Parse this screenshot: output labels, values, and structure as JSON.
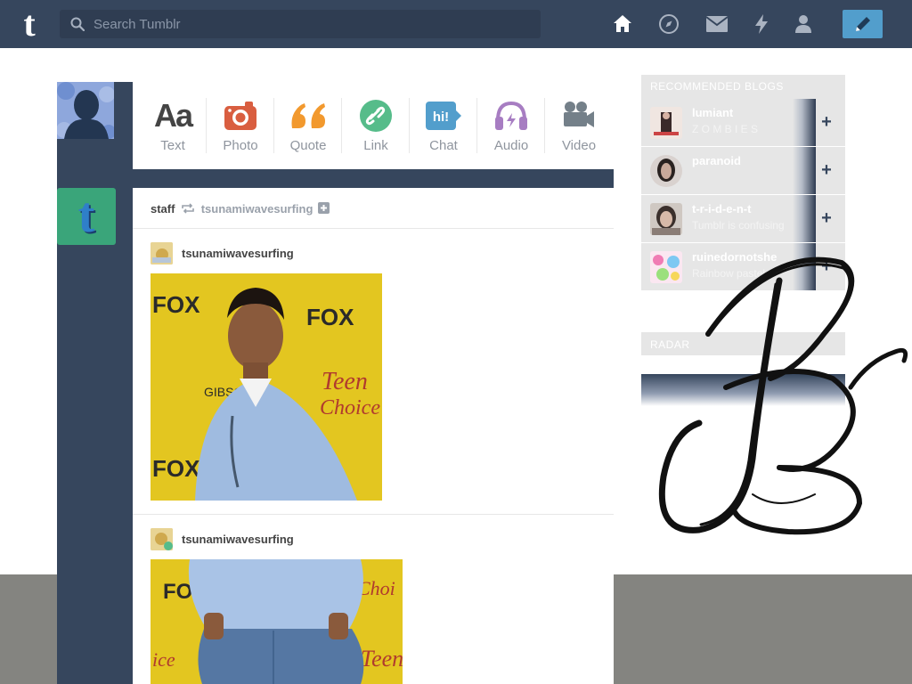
{
  "nav": {
    "search_placeholder": "Search Tumblr",
    "icons": [
      "home-icon",
      "explore-icon",
      "inbox-icon",
      "activity-icon",
      "account-icon",
      "compose-icon"
    ]
  },
  "post_types": [
    {
      "label": "Text",
      "icon": "text-icon",
      "color": "#444444"
    },
    {
      "label": "Photo",
      "icon": "camera-icon",
      "color": "#d95e40"
    },
    {
      "label": "Quote",
      "icon": "quote-icon",
      "color": "#f2992e"
    },
    {
      "label": "Link",
      "icon": "link-icon",
      "color": "#56bc8a"
    },
    {
      "label": "Chat",
      "icon": "chat-icon",
      "color": "#529ecc"
    },
    {
      "label": "Audio",
      "icon": "headphones-icon",
      "color": "#a77dc2"
    },
    {
      "label": "Video",
      "icon": "video-camera-icon",
      "color": "#748089"
    }
  ],
  "feed": {
    "reblogger": "staff",
    "reblog_source": "tsunamiwavesurfing",
    "posts": [
      {
        "author": "tsunamiwavesurfing"
      },
      {
        "author": "tsunamiwavesurfing"
      }
    ]
  },
  "sidebar": {
    "heading": "RECOMMENDED BLOGS",
    "blogs": [
      {
        "name": "lumiant",
        "sub": "Z O M B I E S"
      },
      {
        "name": "paranoid",
        "sub": ""
      },
      {
        "name": "t-r-i-d-e-n-t",
        "sub": "Tumblr is confusing"
      },
      {
        "name": "ruinedornotshe",
        "sub": "Rainbow pastel"
      }
    ],
    "radar_heading": "RADAR"
  },
  "colors": {
    "nav_bg": "#36465d",
    "compose_blue": "#529ecc"
  }
}
